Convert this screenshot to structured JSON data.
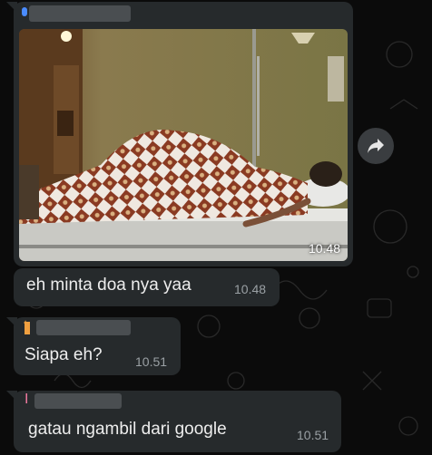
{
  "messages": [
    {
      "type": "image",
      "time": "10.48",
      "image_description_icon": "photo-hospital-bed"
    },
    {
      "type": "text",
      "text": "eh minta doa nya yaa",
      "time": "10.48"
    },
    {
      "type": "text",
      "sender_initial": "t",
      "text": "Siapa eh?",
      "time": "10.51"
    },
    {
      "type": "text",
      "sender_initial": "I",
      "text": "gatau ngambil dari google",
      "time": "10.51"
    }
  ],
  "icons": {
    "forward": "forward-arrow-icon"
  },
  "colors": {
    "background": "#0b0b0b",
    "bubble": "#262a2c",
    "sender_name_orange": "#f0a040",
    "sender_name_pink": "#f07aa0",
    "sender_name_blue": "#4a8cff"
  }
}
